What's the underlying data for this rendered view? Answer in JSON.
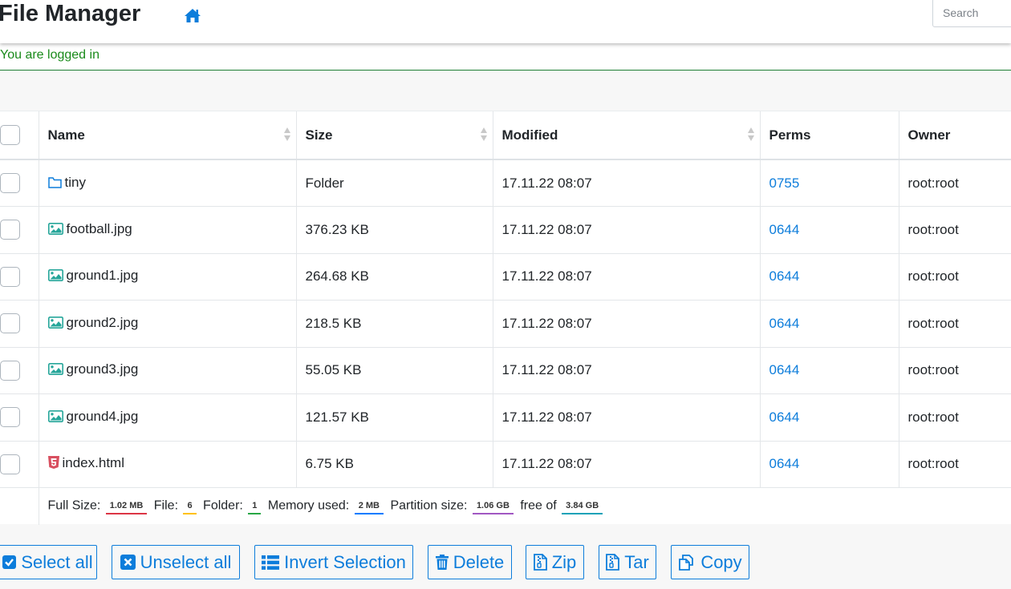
{
  "header": {
    "title": "File Manager",
    "search_placeholder": "Search"
  },
  "message": "You are logged in",
  "table": {
    "columns": [
      "Name",
      "Size",
      "Modified",
      "Perms",
      "Owner"
    ],
    "rows": [
      {
        "icon": "folder-icon",
        "name": "tiny",
        "size": "Folder",
        "modified": "17.11.22 08:07",
        "perms": "0755",
        "owner": "root:root"
      },
      {
        "icon": "image-icon",
        "name": "football.jpg",
        "size": "376.23 KB",
        "modified": "17.11.22 08:07",
        "perms": "0644",
        "owner": "root:root"
      },
      {
        "icon": "image-icon",
        "name": "ground1.jpg",
        "size": "264.68 KB",
        "modified": "17.11.22 08:07",
        "perms": "0644",
        "owner": "root:root"
      },
      {
        "icon": "image-icon",
        "name": "ground2.jpg",
        "size": "218.5 KB",
        "modified": "17.11.22 08:07",
        "perms": "0644",
        "owner": "root:root"
      },
      {
        "icon": "image-icon",
        "name": "ground3.jpg",
        "size": "55.05 KB",
        "modified": "17.11.22 08:07",
        "perms": "0644",
        "owner": "root:root"
      },
      {
        "icon": "image-icon",
        "name": "ground4.jpg",
        "size": "121.57 KB",
        "modified": "17.11.22 08:07",
        "perms": "0644",
        "owner": "root:root"
      },
      {
        "icon": "html5-icon",
        "name": "index.html",
        "size": "6.75 KB",
        "modified": "17.11.22 08:07",
        "perms": "0644",
        "owner": "root:root"
      }
    ]
  },
  "summary": {
    "full_size_label": "Full Size:",
    "full_size": "1.02 MB",
    "file_label": "File:",
    "file_count": "6",
    "folder_label": "Folder:",
    "folder_count": "1",
    "memory_label": "Memory used:",
    "memory": "2 MB",
    "partition_label": "Partition size:",
    "partition": "1.06 GB",
    "free_label": "free of",
    "free": "3.84 GB"
  },
  "actions": {
    "select_all": "Select all",
    "unselect_all": "Unselect all",
    "invert": "Invert Selection",
    "delete": "Delete",
    "zip": "Zip",
    "tar": "Tar",
    "copy": "Copy"
  },
  "colors": {
    "link": "#0d7ddb",
    "success": "#198a1a",
    "folder_icon": "#0d7ddb",
    "image_icon": "#26a69a",
    "html_icon": "#d84f5f"
  }
}
